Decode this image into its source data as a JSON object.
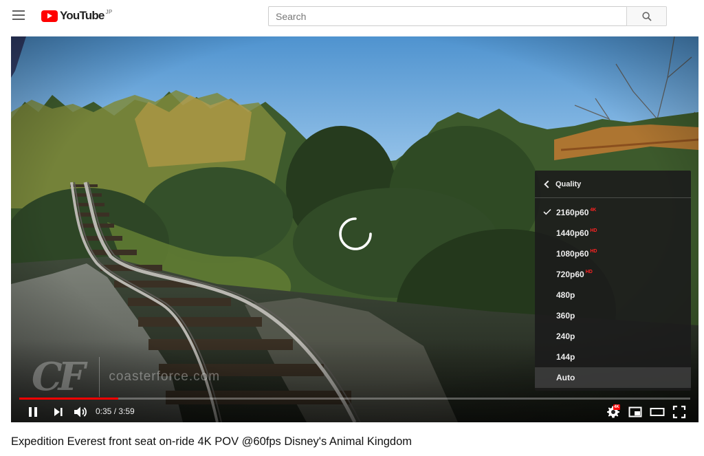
{
  "header": {
    "logo_text": "YouTube",
    "logo_region": "JP",
    "search_placeholder": "Search",
    "menu_icon": "hamburger-icon",
    "search_icon": "search-icon"
  },
  "player": {
    "watermark_logo": "CF",
    "watermark_text": "coasterforce.com",
    "state": "buffering",
    "quality_menu": {
      "title": "Quality",
      "options": [
        {
          "label": "2160p60",
          "badge": "4K",
          "selected": true
        },
        {
          "label": "1440p60",
          "badge": "HD",
          "selected": false
        },
        {
          "label": "1080p60",
          "badge": "HD",
          "selected": false
        },
        {
          "label": "720p60",
          "badge": "HD",
          "selected": false
        },
        {
          "label": "480p",
          "badge": "",
          "selected": false
        },
        {
          "label": "360p",
          "badge": "",
          "selected": false
        },
        {
          "label": "240p",
          "badge": "",
          "selected": false
        },
        {
          "label": "144p",
          "badge": "",
          "selected": false
        },
        {
          "label": "Auto",
          "badge": "",
          "selected": false,
          "hovered": true
        }
      ]
    },
    "progress": {
      "played_fraction": 0.1477,
      "loaded_fraction": 0.1477
    },
    "controls": {
      "current_time": "0:35",
      "duration": "3:59",
      "time_display": "0:35 / 3:59",
      "settings_badge": "4K"
    },
    "accent_color": "#ff0000"
  },
  "video": {
    "title": "Expedition Everest front seat on-ride 4K POV @60fps Disney's Animal Kingdom"
  }
}
